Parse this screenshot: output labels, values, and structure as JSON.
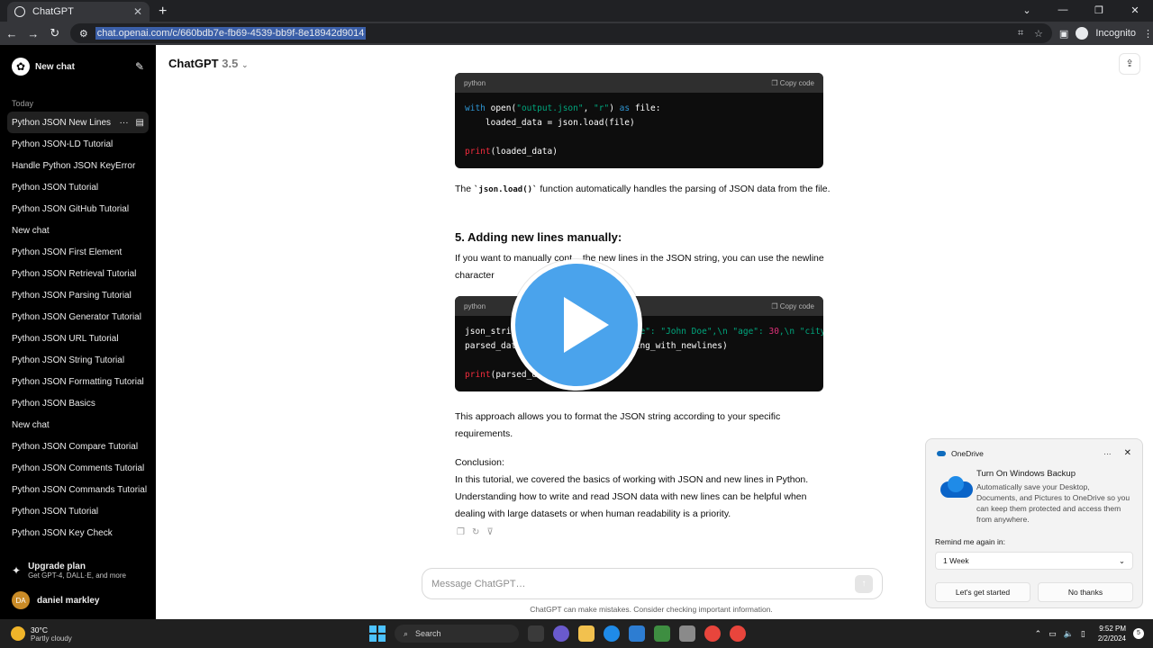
{
  "browser": {
    "tab_title": "ChatGPT",
    "url": "chat.openai.com/c/660bdb7e-fb69-4539-bb9f-8e18942d9014",
    "profile": "Incognito"
  },
  "sidebar": {
    "new_chat": "New chat",
    "section_today": "Today",
    "items": [
      {
        "label": "Python JSON New Lines"
      },
      {
        "label": "Python JSON-LD Tutorial"
      },
      {
        "label": "Handle Python JSON KeyError"
      },
      {
        "label": "Python JSON Tutorial"
      },
      {
        "label": "Python JSON GitHub Tutorial"
      },
      {
        "label": "New chat"
      },
      {
        "label": "Python JSON First Element"
      },
      {
        "label": "Python JSON Retrieval Tutorial"
      },
      {
        "label": "Python JSON Parsing Tutorial"
      },
      {
        "label": "Python JSON Generator Tutorial"
      },
      {
        "label": "Python JSON URL Tutorial"
      },
      {
        "label": "Python JSON String Tutorial"
      },
      {
        "label": "Python JSON Formatting Tutorial"
      },
      {
        "label": "Python JSON Basics"
      },
      {
        "label": "New chat"
      },
      {
        "label": "Python JSON Compare Tutorial"
      },
      {
        "label": "Python JSON Comments Tutorial"
      },
      {
        "label": "Python JSON Commands Tutorial"
      },
      {
        "label": "Python JSON Tutorial"
      },
      {
        "label": "Python JSON Key Check"
      }
    ],
    "upgrade_title": "Upgrade plan",
    "upgrade_sub": "Get GPT-4, DALL·E, and more",
    "user_initials": "DA",
    "user_name": "daniel markley"
  },
  "main": {
    "model": "ChatGPT",
    "model_version": "3.5",
    "code1": {
      "lang": "python",
      "copy": "Copy code"
    },
    "para1_pre": "The ",
    "para1_code": "`json.load()`",
    "para1_post": " function automatically handles the parsing of JSON data from the file.",
    "heading5": "5. Adding new lines manually:",
    "para2": "If you want to manually cont... the new lines in the JSON string, you can use the newline character",
    "code2": {
      "lang": "python",
      "copy": "Copy code"
    },
    "para3": "This approach allows you to format the JSON string according to your specific requirements.",
    "conclusion_label": "Conclusion:",
    "conclusion": "In this tutorial, we covered the basics of working with JSON and new lines in Python. Understanding how to write and read JSON data with new lines can be helpful when dealing with large datasets or when human readability is a priority.",
    "composer_placeholder": "Message ChatGPT…",
    "disclaimer": "ChatGPT can make mistakes. Consider checking important information."
  },
  "toast": {
    "app": "OneDrive",
    "title": "Turn On Windows Backup",
    "desc": "Automatically save your Desktop, Documents, and Pictures to OneDrive so you can keep them protected and access them from anywhere.",
    "remind_label": "Remind me again in:",
    "remind_value": "1 Week",
    "primary": "Let's get started",
    "secondary": "No thanks"
  },
  "taskbar": {
    "temp": "30°C",
    "condition": "Partly cloudy",
    "search": "Search",
    "time": "9:52 PM",
    "date": "2/2/2024",
    "notif_count": "5"
  },
  "colors": {
    "accent_play": "#4aa3ec",
    "code_bg": "#0d0d0d",
    "sidebar_bg": "#000000"
  }
}
